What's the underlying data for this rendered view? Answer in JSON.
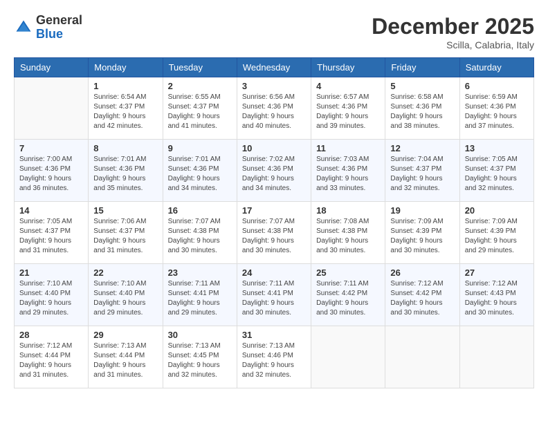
{
  "header": {
    "logo_general": "General",
    "logo_blue": "Blue",
    "month_title": "December 2025",
    "location": "Scilla, Calabria, Italy"
  },
  "days_of_week": [
    "Sunday",
    "Monday",
    "Tuesday",
    "Wednesday",
    "Thursday",
    "Friday",
    "Saturday"
  ],
  "weeks": [
    [
      {
        "num": "",
        "sunrise": "",
        "sunset": "",
        "daylight": ""
      },
      {
        "num": "1",
        "sunrise": "Sunrise: 6:54 AM",
        "sunset": "Sunset: 4:37 PM",
        "daylight": "Daylight: 9 hours and 42 minutes."
      },
      {
        "num": "2",
        "sunrise": "Sunrise: 6:55 AM",
        "sunset": "Sunset: 4:37 PM",
        "daylight": "Daylight: 9 hours and 41 minutes."
      },
      {
        "num": "3",
        "sunrise": "Sunrise: 6:56 AM",
        "sunset": "Sunset: 4:36 PM",
        "daylight": "Daylight: 9 hours and 40 minutes."
      },
      {
        "num": "4",
        "sunrise": "Sunrise: 6:57 AM",
        "sunset": "Sunset: 4:36 PM",
        "daylight": "Daylight: 9 hours and 39 minutes."
      },
      {
        "num": "5",
        "sunrise": "Sunrise: 6:58 AM",
        "sunset": "Sunset: 4:36 PM",
        "daylight": "Daylight: 9 hours and 38 minutes."
      },
      {
        "num": "6",
        "sunrise": "Sunrise: 6:59 AM",
        "sunset": "Sunset: 4:36 PM",
        "daylight": "Daylight: 9 hours and 37 minutes."
      }
    ],
    [
      {
        "num": "7",
        "sunrise": "Sunrise: 7:00 AM",
        "sunset": "Sunset: 4:36 PM",
        "daylight": "Daylight: 9 hours and 36 minutes."
      },
      {
        "num": "8",
        "sunrise": "Sunrise: 7:01 AM",
        "sunset": "Sunset: 4:36 PM",
        "daylight": "Daylight: 9 hours and 35 minutes."
      },
      {
        "num": "9",
        "sunrise": "Sunrise: 7:01 AM",
        "sunset": "Sunset: 4:36 PM",
        "daylight": "Daylight: 9 hours and 34 minutes."
      },
      {
        "num": "10",
        "sunrise": "Sunrise: 7:02 AM",
        "sunset": "Sunset: 4:36 PM",
        "daylight": "Daylight: 9 hours and 34 minutes."
      },
      {
        "num": "11",
        "sunrise": "Sunrise: 7:03 AM",
        "sunset": "Sunset: 4:36 PM",
        "daylight": "Daylight: 9 hours and 33 minutes."
      },
      {
        "num": "12",
        "sunrise": "Sunrise: 7:04 AM",
        "sunset": "Sunset: 4:37 PM",
        "daylight": "Daylight: 9 hours and 32 minutes."
      },
      {
        "num": "13",
        "sunrise": "Sunrise: 7:05 AM",
        "sunset": "Sunset: 4:37 PM",
        "daylight": "Daylight: 9 hours and 32 minutes."
      }
    ],
    [
      {
        "num": "14",
        "sunrise": "Sunrise: 7:05 AM",
        "sunset": "Sunset: 4:37 PM",
        "daylight": "Daylight: 9 hours and 31 minutes."
      },
      {
        "num": "15",
        "sunrise": "Sunrise: 7:06 AM",
        "sunset": "Sunset: 4:37 PM",
        "daylight": "Daylight: 9 hours and 31 minutes."
      },
      {
        "num": "16",
        "sunrise": "Sunrise: 7:07 AM",
        "sunset": "Sunset: 4:38 PM",
        "daylight": "Daylight: 9 hours and 30 minutes."
      },
      {
        "num": "17",
        "sunrise": "Sunrise: 7:07 AM",
        "sunset": "Sunset: 4:38 PM",
        "daylight": "Daylight: 9 hours and 30 minutes."
      },
      {
        "num": "18",
        "sunrise": "Sunrise: 7:08 AM",
        "sunset": "Sunset: 4:38 PM",
        "daylight": "Daylight: 9 hours and 30 minutes."
      },
      {
        "num": "19",
        "sunrise": "Sunrise: 7:09 AM",
        "sunset": "Sunset: 4:39 PM",
        "daylight": "Daylight: 9 hours and 30 minutes."
      },
      {
        "num": "20",
        "sunrise": "Sunrise: 7:09 AM",
        "sunset": "Sunset: 4:39 PM",
        "daylight": "Daylight: 9 hours and 29 minutes."
      }
    ],
    [
      {
        "num": "21",
        "sunrise": "Sunrise: 7:10 AM",
        "sunset": "Sunset: 4:40 PM",
        "daylight": "Daylight: 9 hours and 29 minutes."
      },
      {
        "num": "22",
        "sunrise": "Sunrise: 7:10 AM",
        "sunset": "Sunset: 4:40 PM",
        "daylight": "Daylight: 9 hours and 29 minutes."
      },
      {
        "num": "23",
        "sunrise": "Sunrise: 7:11 AM",
        "sunset": "Sunset: 4:41 PM",
        "daylight": "Daylight: 9 hours and 29 minutes."
      },
      {
        "num": "24",
        "sunrise": "Sunrise: 7:11 AM",
        "sunset": "Sunset: 4:41 PM",
        "daylight": "Daylight: 9 hours and 30 minutes."
      },
      {
        "num": "25",
        "sunrise": "Sunrise: 7:11 AM",
        "sunset": "Sunset: 4:42 PM",
        "daylight": "Daylight: 9 hours and 30 minutes."
      },
      {
        "num": "26",
        "sunrise": "Sunrise: 7:12 AM",
        "sunset": "Sunset: 4:42 PM",
        "daylight": "Daylight: 9 hours and 30 minutes."
      },
      {
        "num": "27",
        "sunrise": "Sunrise: 7:12 AM",
        "sunset": "Sunset: 4:43 PM",
        "daylight": "Daylight: 9 hours and 30 minutes."
      }
    ],
    [
      {
        "num": "28",
        "sunrise": "Sunrise: 7:12 AM",
        "sunset": "Sunset: 4:44 PM",
        "daylight": "Daylight: 9 hours and 31 minutes."
      },
      {
        "num": "29",
        "sunrise": "Sunrise: 7:13 AM",
        "sunset": "Sunset: 4:44 PM",
        "daylight": "Daylight: 9 hours and 31 minutes."
      },
      {
        "num": "30",
        "sunrise": "Sunrise: 7:13 AM",
        "sunset": "Sunset: 4:45 PM",
        "daylight": "Daylight: 9 hours and 32 minutes."
      },
      {
        "num": "31",
        "sunrise": "Sunrise: 7:13 AM",
        "sunset": "Sunset: 4:46 PM",
        "daylight": "Daylight: 9 hours and 32 minutes."
      },
      {
        "num": "",
        "sunrise": "",
        "sunset": "",
        "daylight": ""
      },
      {
        "num": "",
        "sunrise": "",
        "sunset": "",
        "daylight": ""
      },
      {
        "num": "",
        "sunrise": "",
        "sunset": "",
        "daylight": ""
      }
    ]
  ]
}
